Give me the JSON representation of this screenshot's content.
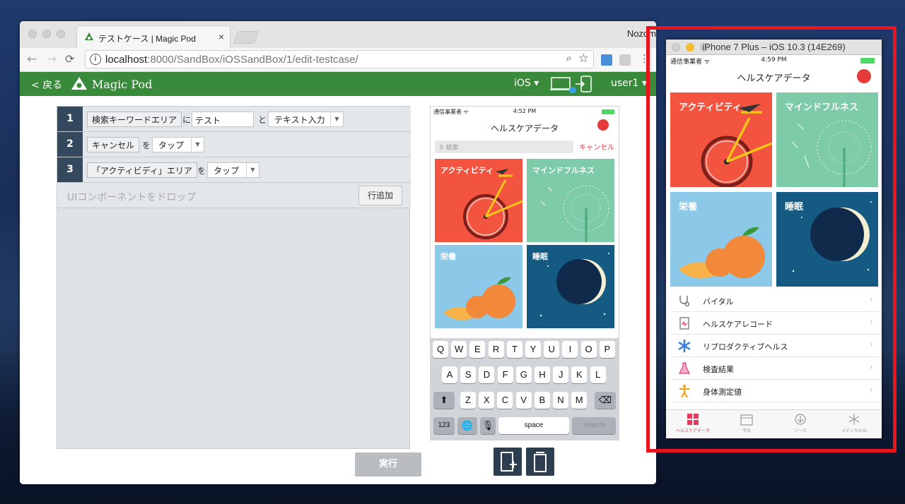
{
  "browser": {
    "tab_title": "テストケース | Magic Pod",
    "tab_close": "×",
    "profile_name": "Nozom",
    "url_host": "localhost",
    "url_rest": ":8000/SandBox/iOSSandBox/1/edit-testcase/"
  },
  "app": {
    "back_label": "< 戻る",
    "brand": "Magic Pod",
    "os_label": "iOS ▾",
    "user_label": "user1 ▾",
    "accent": "#3a8a3c"
  },
  "steps": [
    {
      "num": "1",
      "element": "検索キーワードエリア",
      "particle1": "に",
      "value": "テスト",
      "particle2": "と",
      "action": "テキスト入力"
    },
    {
      "num": "2",
      "element": "キャンセル",
      "particle1": "を",
      "action": "タップ"
    },
    {
      "num": "3",
      "element": "「アクティビディ」エリア",
      "particle1": "を",
      "action": "タップ"
    }
  ],
  "editor": {
    "drop_hint": "UIコンポーネントをドロップ",
    "add_row": "行追加",
    "run": "実行"
  },
  "preview": {
    "carrier": "通信事業者 ",
    "time": "4:52 PM",
    "title": "ヘルスケアデータ",
    "search_placeholder": "検索",
    "cancel": "キャンセル",
    "tiles": [
      "アクティビティ",
      "マインドフルネス",
      "栄養",
      "睡眠"
    ],
    "keyboard": {
      "row1": [
        "Q",
        "W",
        "E",
        "R",
        "T",
        "Y",
        "U",
        "I",
        "O",
        "P"
      ],
      "row2": [
        "A",
        "S",
        "D",
        "F",
        "G",
        "H",
        "J",
        "K",
        "L"
      ],
      "row3": [
        "Z",
        "X",
        "C",
        "V",
        "B",
        "N",
        "M"
      ],
      "num": "123",
      "space": "space",
      "search": "Search"
    }
  },
  "simulator": {
    "window_title": "iPhone 7 Plus – iOS 10.3 (14E269)",
    "carrier": "通信事業者 ",
    "time": "4:59 PM",
    "title": "ヘルスケアデータ",
    "tiles": [
      "アクティビティ",
      "マインドフルネス",
      "栄養",
      "睡眠"
    ],
    "rows": [
      "バイタル",
      "ヘルスケアレコード",
      "リプロダクティブヘルス",
      "検査結果",
      "身体測定値"
    ],
    "tabs": [
      "ヘルスケアデータ",
      "今日",
      "ソース",
      "メディカルID"
    ],
    "highlight": "#e8161c"
  }
}
